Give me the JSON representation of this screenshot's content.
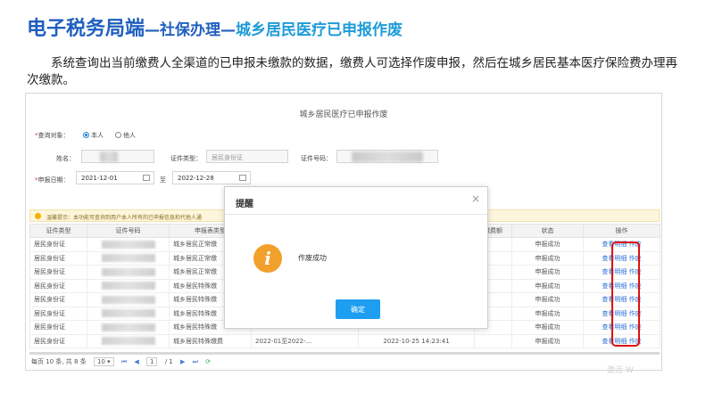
{
  "slide": {
    "title_main": "电子税务局端",
    "title_sep1": "—",
    "title_sub1": "社保办理",
    "title_sep2": "—",
    "title_sub2": "城乡居民医疗已申报作废",
    "description": "系统查询出当前缴费人全渠道的已申报未缴款的数据，缴费人可选择作废申报，然后在城乡居民基本医疗保险费办理再次缴款。"
  },
  "form": {
    "page_title": "城乡居民医疗已申报作废",
    "query_target_label": "查询对象：",
    "radio_self": "本人",
    "radio_other": "他人",
    "name_label": "姓名：",
    "id_type_label": "证件类型：",
    "id_type_value": "居民身份证",
    "id_number_label": "证件号码：",
    "date_label": "申报日期：",
    "date_from": "2021-12-01",
    "date_to_sep": "至",
    "date_to": "2022-12-28"
  },
  "notice": "温馨提示：本功能可查询到用户本人所有的已申报信息和代他人通",
  "table": {
    "headers": [
      "证件类型",
      "证件号码",
      "申报表类型",
      "",
      "",
      "缴费额",
      "状态",
      "操作"
    ],
    "rows": [
      {
        "id_type": "居民身份证",
        "form_type": "城乡居民正常缴",
        "period": "",
        "date": "",
        "status": "申报成功",
        "view": "查看明细",
        "void": "作废"
      },
      {
        "id_type": "居民身份证",
        "form_type": "城乡居民正常缴",
        "period": "",
        "date": "",
        "status": "申报成功",
        "view": "查看明细",
        "void": "作废"
      },
      {
        "id_type": "居民身份证",
        "form_type": "城乡居民正常缴",
        "period": "",
        "date": "",
        "status": "申报成功",
        "view": "查看明细",
        "void": "作废"
      },
      {
        "id_type": "居民身份证",
        "form_type": "城乡居民特殊缴",
        "period": "",
        "date": "",
        "status": "申报成功",
        "view": "查看明细",
        "void": "作废"
      },
      {
        "id_type": "居民身份证",
        "form_type": "城乡居民特殊缴",
        "period": "",
        "date": "",
        "status": "申报成功",
        "view": "查看明细",
        "void": "作废"
      },
      {
        "id_type": "居民身份证",
        "form_type": "城乡居民特殊缴",
        "period": "",
        "date": "",
        "status": "申报成功",
        "view": "查看明细",
        "void": "作废"
      },
      {
        "id_type": "居民身份证",
        "form_type": "城乡居民特殊缴",
        "period": "",
        "date": "",
        "status": "申报成功",
        "view": "查看明细",
        "void": "作废"
      },
      {
        "id_type": "居民身份证",
        "form_type": "城乡居民特殊缴费",
        "period": "2022-01至2022-...",
        "date": "2022-10-25 14:23:41",
        "status": "申报成功",
        "view": "查看明细",
        "void": "作废"
      }
    ]
  },
  "pager": {
    "per_page_text": "每页 10 条, 共 8 条",
    "size_value": "10 ▾",
    "first": "⏮",
    "prev": "◀",
    "page_input": "1",
    "page_total": "/ 1",
    "next": "▶",
    "last": "⏭",
    "refresh": "⟳"
  },
  "dialog": {
    "title": "提醒",
    "close": "×",
    "icon_glyph": "i",
    "message": "作废成功",
    "confirm": "确定"
  },
  "watermark": "激活 W"
}
